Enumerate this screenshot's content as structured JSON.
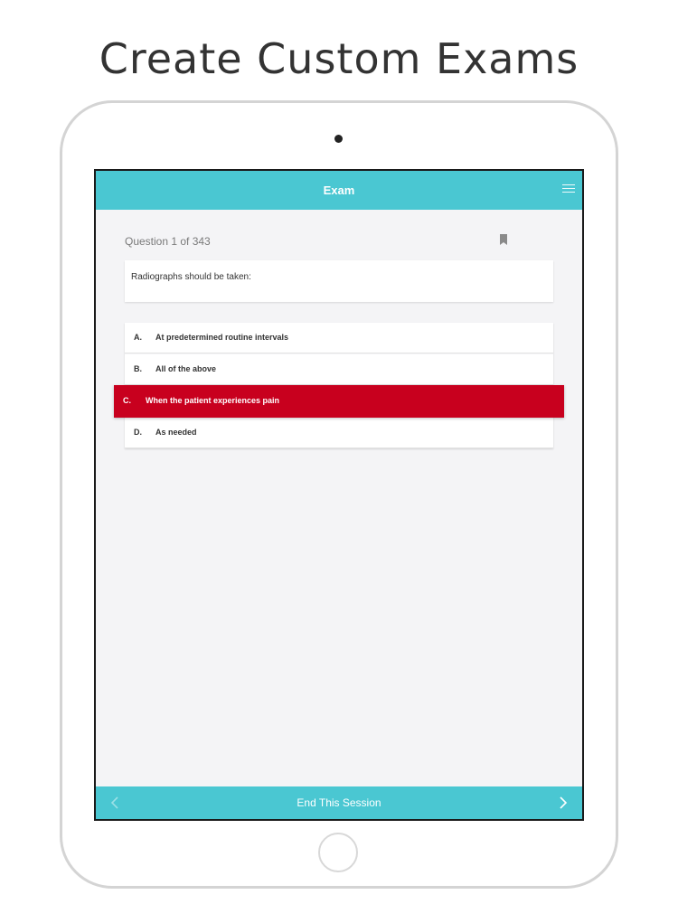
{
  "headline": "Create Custom Exams",
  "app": {
    "title": "Exam",
    "question_counter": "Question 1 of 343",
    "question_text": "Radiographs should be taken:",
    "answers": [
      {
        "letter": "A.",
        "text": "At predetermined routine intervals",
        "selected": false
      },
      {
        "letter": "B.",
        "text": "All of the above",
        "selected": false
      },
      {
        "letter": "C.",
        "text": "When the patient experiences pain",
        "selected": true
      },
      {
        "letter": "D.",
        "text": "As needed",
        "selected": false
      }
    ],
    "end_session_label": "End This Session"
  },
  "colors": {
    "accent": "#4ac7d2",
    "selected_answer": "#c8001e",
    "background": "#f4f4f6"
  },
  "icons": {
    "menu": "hamburger-menu-icon",
    "bookmark": "bookmark-icon",
    "prev": "chevron-left-icon",
    "next": "chevron-right-icon"
  }
}
